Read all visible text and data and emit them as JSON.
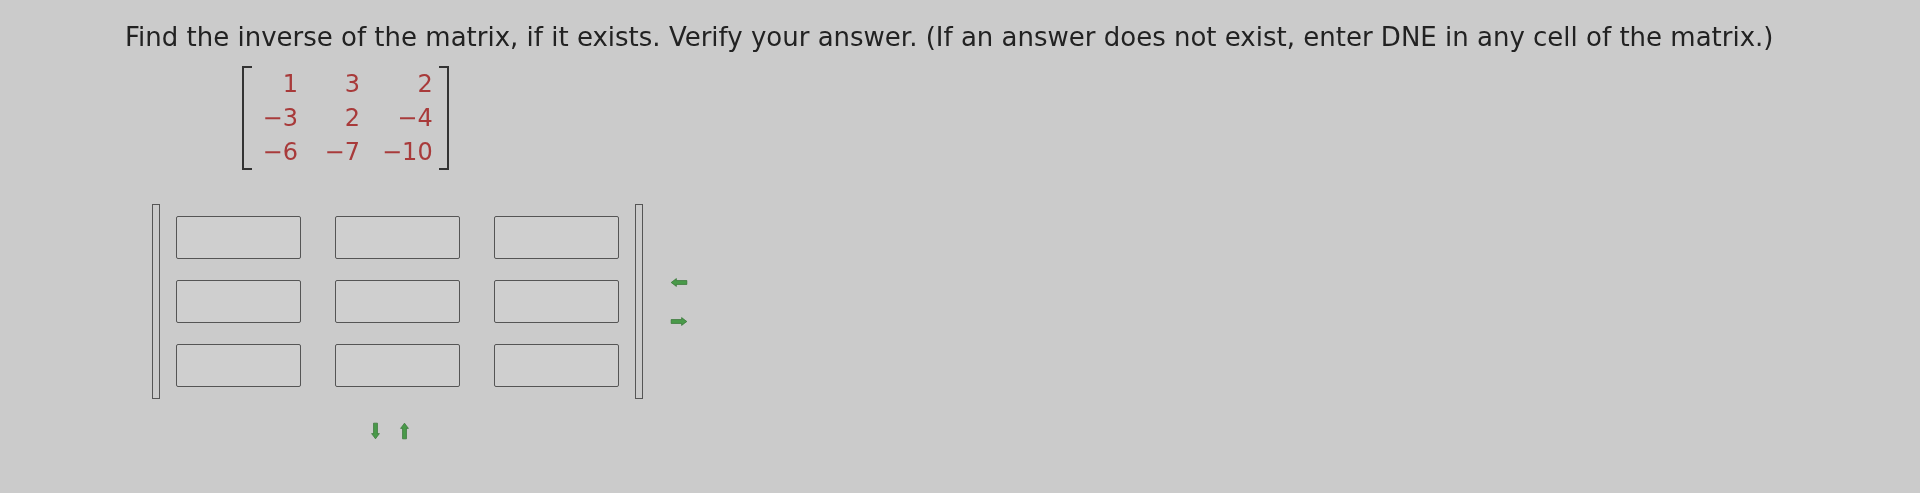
{
  "question": "Find the inverse of the matrix, if it exists. Verify your answer. (If an answer does not exist, enter DNE in any cell of the matrix.)",
  "given_matrix": [
    [
      "1",
      "3",
      "2"
    ],
    [
      "−3",
      "2",
      "−4"
    ],
    [
      "−6",
      "−7",
      "−10"
    ]
  ],
  "answer_matrix": [
    [
      {
        "kind": "input"
      },
      {
        "kind": "input"
      },
      {
        "kind": "input"
      }
    ],
    [
      {
        "kind": "input"
      },
      {
        "kind": "input"
      },
      {
        "kind": "input"
      }
    ],
    [
      {
        "kind": "input"
      },
      {
        "kind": "input"
      },
      {
        "kind": "input"
      }
    ]
  ]
}
